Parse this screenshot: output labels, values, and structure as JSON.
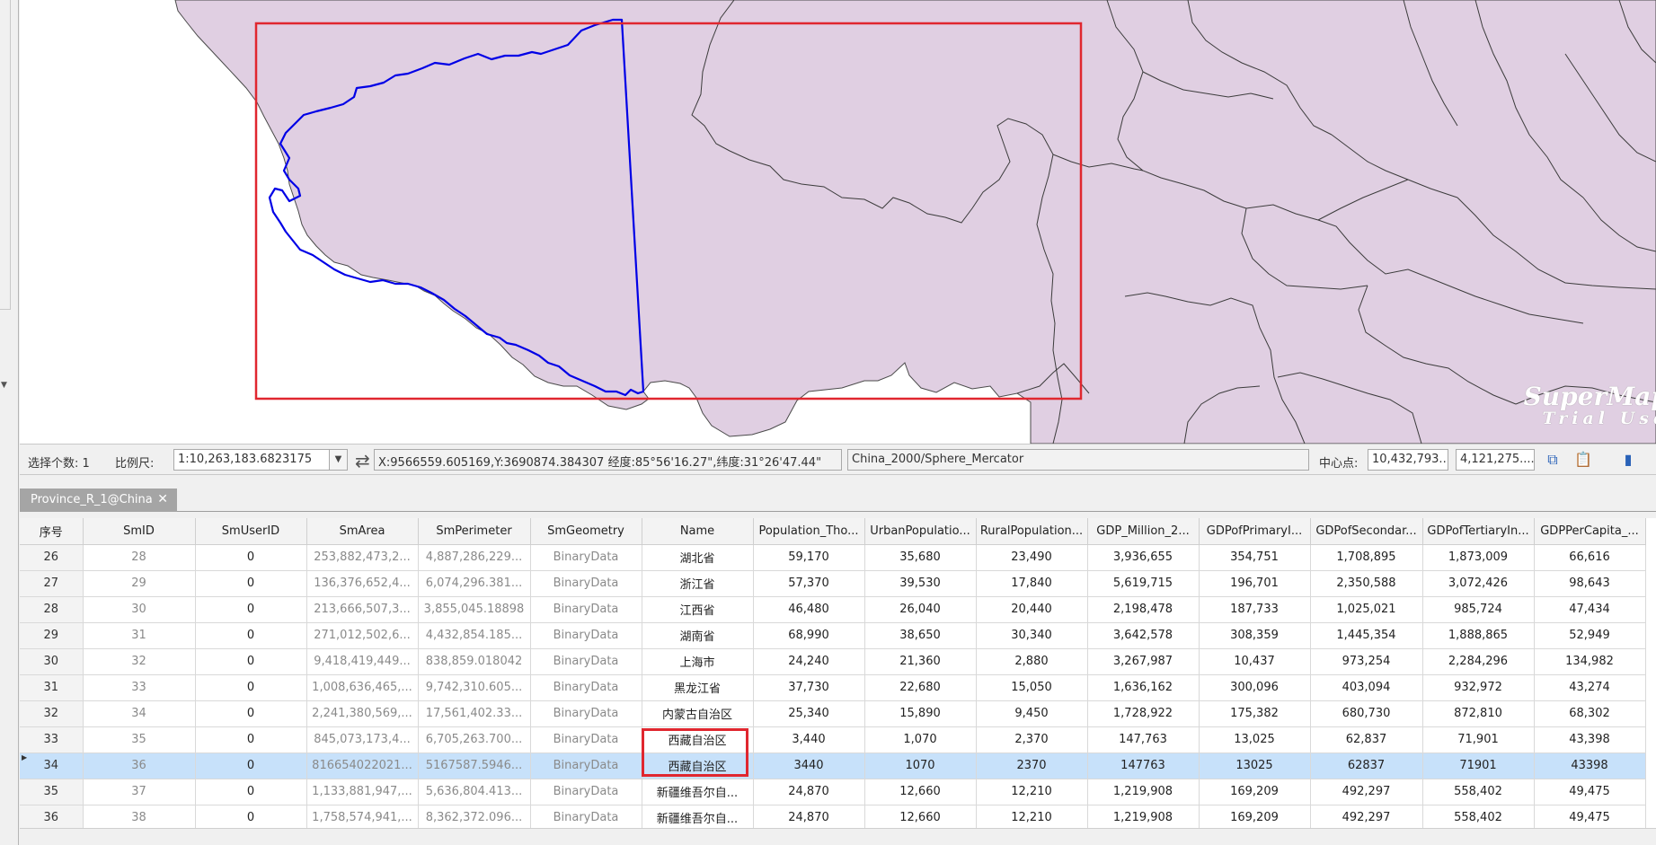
{
  "status_bar": {
    "selected_count_label": "选择个数: 1",
    "scale_label": "比例尺:",
    "scale_value": "1:10,263,183.6823175",
    "coordinates": "X:9566559.605169,Y:3690874.384307   经度:85°56'16.27\",纬度:31°26'47.44\"",
    "projection": "China_2000/Sphere_Mercator",
    "center_label": "中心点:",
    "center_x": "10,432,793...",
    "center_y": "4,121,275...."
  },
  "map": {
    "watermark_line1": "SuperMap",
    "watermark_line2": "Trial Use",
    "land_color": "#e0cfe2",
    "selection_color": "#0000e6",
    "highlight_color": "#e0272f"
  },
  "attribute_tab": {
    "label": "Province_R_1@China"
  },
  "grid": {
    "columns": [
      "序号",
      "SmID",
      "SmUserID",
      "SmArea",
      "SmPerimeter",
      "SmGeometry",
      "Name",
      "Population_Tho...",
      "UrbanPopulatio...",
      "RuralPopulation...",
      "GDP_Million_2...",
      "GDPofPrimaryI...",
      "GDPofSecondar...",
      "GDPofTertiaryIn...",
      "GDPPerCapita_..."
    ],
    "rows": [
      [
        "26",
        "28",
        "0",
        "253,882,473,2...",
        "4,887,286,229...",
        "BinaryData",
        "湖北省",
        "59,170",
        "35,680",
        "23,490",
        "3,936,655",
        "354,751",
        "1,708,895",
        "1,873,009",
        "66,616"
      ],
      [
        "27",
        "29",
        "0",
        "136,376,652,4...",
        "6,074,296.381...",
        "BinaryData",
        "浙江省",
        "57,370",
        "39,530",
        "17,840",
        "5,619,715",
        "196,701",
        "2,350,588",
        "3,072,426",
        "98,643"
      ],
      [
        "28",
        "30",
        "0",
        "213,666,507,3...",
        "3,855,045.18898",
        "BinaryData",
        "江西省",
        "46,480",
        "26,040",
        "20,440",
        "2,198,478",
        "187,733",
        "1,025,021",
        "985,724",
        "47,434"
      ],
      [
        "29",
        "31",
        "0",
        "271,012,502,6...",
        "4,432,854.185...",
        "BinaryData",
        "湖南省",
        "68,990",
        "38,650",
        "30,340",
        "3,642,578",
        "308,359",
        "1,445,354",
        "1,888,865",
        "52,949"
      ],
      [
        "30",
        "32",
        "0",
        "9,418,419,449...",
        "838,859.018042",
        "BinaryData",
        "上海市",
        "24,240",
        "21,360",
        "2,880",
        "3,267,987",
        "10,437",
        "973,254",
        "2,284,296",
        "134,982"
      ],
      [
        "31",
        "33",
        "0",
        "1,008,636,465,...",
        "9,742,310.605...",
        "BinaryData",
        "黑龙江省",
        "37,730",
        "22,680",
        "15,050",
        "1,636,162",
        "300,096",
        "403,094",
        "932,972",
        "43,274"
      ],
      [
        "32",
        "34",
        "0",
        "2,241,380,569,...",
        "17,561,402.33...",
        "BinaryData",
        "内蒙古自治区",
        "25,340",
        "15,890",
        "9,450",
        "1,728,922",
        "175,382",
        "680,730",
        "872,810",
        "68,302"
      ],
      [
        "33",
        "35",
        "0",
        "845,073,173,4...",
        "6,705,263.700...",
        "BinaryData",
        "西藏自治区",
        "3,440",
        "1,070",
        "2,370",
        "147,763",
        "13,025",
        "62,837",
        "71,901",
        "43,398"
      ],
      [
        "34",
        "36",
        "0",
        "816654022021...",
        "5167587.5946...",
        "BinaryData",
        "西藏自治区",
        "3440",
        "1070",
        "2370",
        "147763",
        "13025",
        "62837",
        "71901",
        "43398"
      ],
      [
        "35",
        "37",
        "0",
        "1,133,881,947,...",
        "5,636,804.413...",
        "BinaryData",
        "新疆维吾尔自...",
        "24,870",
        "12,660",
        "12,210",
        "1,219,908",
        "169,209",
        "492,297",
        "558,402",
        "49,475"
      ],
      [
        "36",
        "38",
        "0",
        "1,758,574,941,...",
        "8,362,372.096...",
        "BinaryData",
        "新疆维吾尔自...",
        "24,870",
        "12,660",
        "12,210",
        "1,219,908",
        "169,209",
        "492,297",
        "558,402",
        "49,475"
      ]
    ],
    "selected_row": 8
  }
}
